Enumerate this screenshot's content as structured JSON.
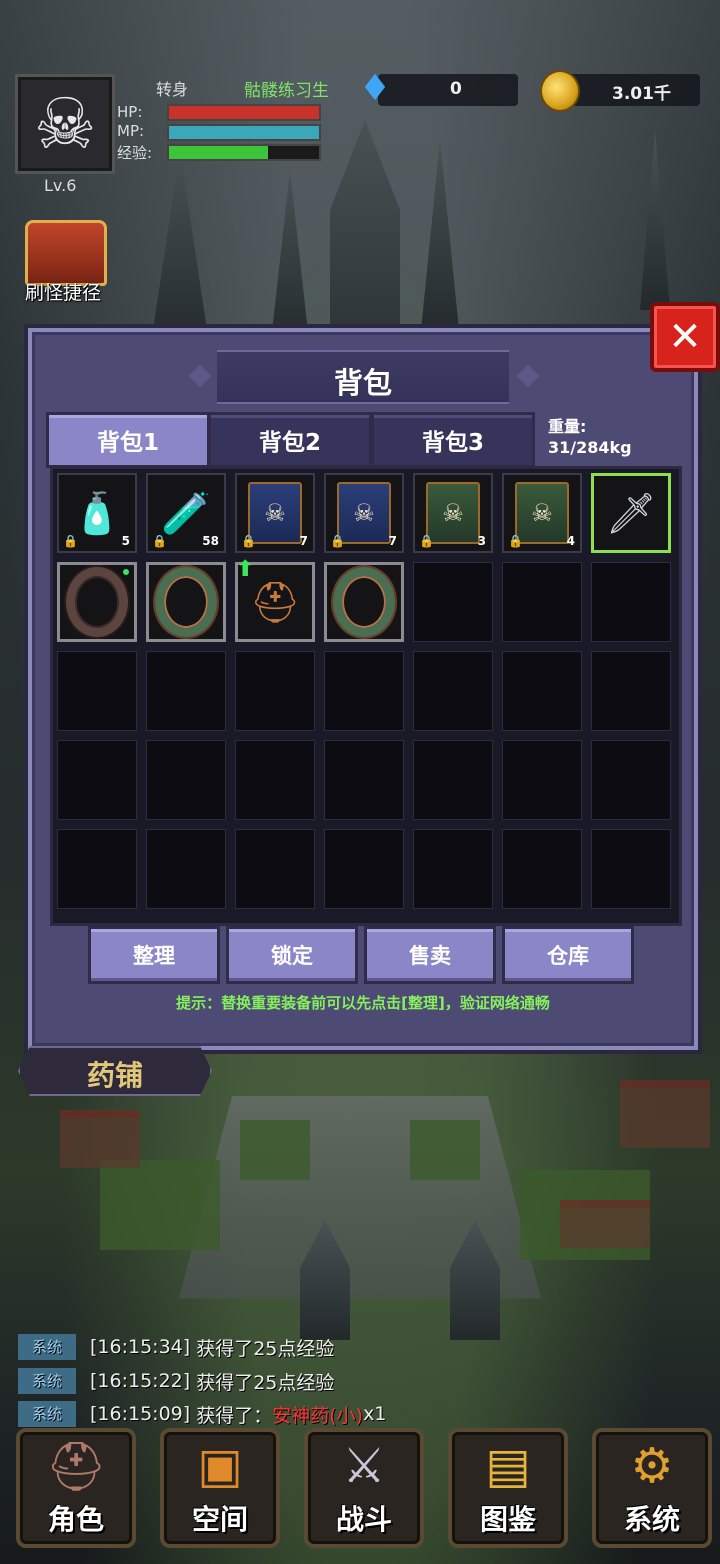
{
  "hud": {
    "level": "Lv.6",
    "rebirth_label": "转身",
    "title": "骷髅练习生",
    "hp_label": "HP:",
    "mp_label": "MP:",
    "exp_label": "经验:",
    "hp_fill": 1.0,
    "mp_fill": 1.0,
    "exp_fill": 0.66,
    "gems": "0",
    "gold": "3.01千",
    "shortcut_label": "刷怪捷径"
  },
  "bag": {
    "title": "背包",
    "close": "✕",
    "tabs": [
      "背包1",
      "背包2",
      "背包3"
    ],
    "active_tab": 0,
    "weight_label": "重量:",
    "weight_value": "31/284kg",
    "items": [
      {
        "icon": "blood-potion-icon",
        "qty": "5",
        "locked": true
      },
      {
        "icon": "mana-vial-icon",
        "qty": "58",
        "locked": true
      },
      {
        "icon": "skill-book-blue-icon",
        "qty": "7",
        "locked": true
      },
      {
        "icon": "skill-book-blue-icon",
        "qty": "7",
        "locked": true
      },
      {
        "icon": "skill-book-green-icon",
        "qty": "3",
        "locked": true
      },
      {
        "icon": "skill-book-green-icon",
        "qty": "4",
        "locked": true
      },
      {
        "icon": "sword-icon",
        "qty": "",
        "locked": false
      },
      {
        "icon": "dark-bracelet-icon",
        "qty": "",
        "locked": false
      },
      {
        "icon": "bronze-ring-icon",
        "qty": "",
        "locked": false
      },
      {
        "icon": "knight-helmet-icon",
        "qty": "",
        "locked": false
      },
      {
        "icon": "bronze-ring-icon",
        "qty": "",
        "locked": false
      }
    ],
    "buttons": [
      "整理",
      "锁定",
      "售卖",
      "仓库"
    ],
    "tip": "提示：替换重要装备前可以先点击[整理]，验证网络通畅"
  },
  "shop_label": "药铺",
  "log": [
    {
      "tag": "系统",
      "time": "[16:15:34]",
      "text": "获得了25点经验",
      "item": "",
      "suffix": ""
    },
    {
      "tag": "系统",
      "time": "[16:15:22]",
      "text": "获得了25点经验",
      "item": "",
      "suffix": ""
    },
    {
      "tag": "系统",
      "time": "[16:15:09]",
      "text": "获得了：",
      "item": "安神药(小)",
      "suffix": "x1"
    }
  ],
  "nav": [
    "角色",
    "空间",
    "战斗",
    "图鉴",
    "系统"
  ],
  "colors": {
    "hp": "#c8322a",
    "mp": "#3aa8b8",
    "exp": "#3cc43a",
    "panel": "#4d4a74",
    "tab_active": "#8a86c8"
  }
}
